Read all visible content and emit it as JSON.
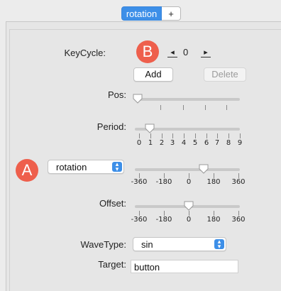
{
  "tabs": [
    {
      "label": "rotation",
      "active": true
    },
    {
      "label": "+",
      "active": false
    }
  ],
  "badges": {
    "a": "A",
    "b": "B"
  },
  "keycycle": {
    "label": "KeyCycle:",
    "prev_icon": "◂",
    "next_icon": "▸",
    "value": "0"
  },
  "buttons": {
    "add": "Add",
    "delete": "Delete"
  },
  "pos": {
    "label": "Pos:",
    "value_fraction": 0.0
  },
  "period": {
    "label": "Period:",
    "ticks": [
      "0",
      "1",
      "2",
      "3",
      "4",
      "5",
      "6",
      "7",
      "8",
      "9"
    ],
    "value": 1
  },
  "rotation": {
    "dropdown_value": "rotation",
    "ticks": [
      "-360",
      "-180",
      "0",
      "180",
      "360"
    ],
    "value": 90
  },
  "offset": {
    "label": "Offset:",
    "ticks": [
      "-360",
      "-180",
      "0",
      "180",
      "360"
    ],
    "value": 0
  },
  "wavetype": {
    "label": "WaveType:",
    "value": "sin"
  },
  "target": {
    "label": "Target:",
    "value": "button"
  },
  "colors": {
    "accent": "#3d8fe8",
    "badge": "#ee5f4c",
    "background": "#ececec"
  }
}
